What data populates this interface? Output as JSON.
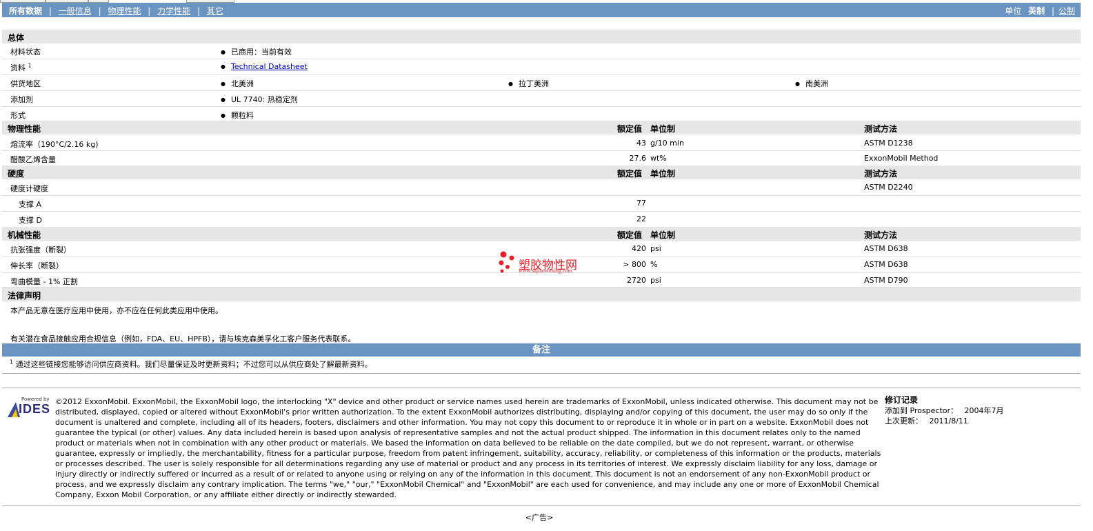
{
  "nav": {
    "tabs": [
      "所有数据",
      "一般信息",
      "物理性能",
      "力学性能",
      "其它"
    ],
    "units_label": "单位",
    "unit_current": "英制",
    "unit_other": "公制"
  },
  "general": {
    "title": "总体",
    "rows": [
      {
        "label": "材料状态",
        "values": [
          "已商用：当前有效"
        ]
      },
      {
        "label": "资料",
        "sup": "1",
        "values": [
          "Technical Datasheet"
        ]
      },
      {
        "label": "供货地区",
        "values": [
          "北美洲",
          "拉丁美洲",
          "南美洲"
        ]
      },
      {
        "label": "添加剂",
        "values": [
          "UL 7740: 热稳定剂"
        ]
      },
      {
        "label": "形式",
        "values": [
          "颗粒料"
        ]
      }
    ]
  },
  "headers": {
    "nominal": "额定值",
    "unit": "单位制",
    "method": "测试方法"
  },
  "physical": {
    "title": "物理性能",
    "rows": [
      {
        "label": "熔流率（190°C/2.16 kg)",
        "value": "43",
        "unit": "g/10 min",
        "method": "ASTM D1238"
      },
      {
        "label": "醋酸乙烯含量",
        "value": "27.6",
        "unit": "wt%",
        "method": "ExxonMobil Method"
      }
    ]
  },
  "hardness": {
    "title": "硬度",
    "rows": [
      {
        "label": "硬度计硬度",
        "value": "",
        "unit": "",
        "method": "ASTM D2240"
      },
      {
        "label": "支撑 A",
        "value": "77",
        "unit": "",
        "method": ""
      },
      {
        "label": "支撑 D",
        "value": "22",
        "unit": "",
        "method": ""
      }
    ]
  },
  "mechanical": {
    "title": "机械性能",
    "rows": [
      {
        "label": "抗张强度（断裂）",
        "value": "420",
        "unit": "psi",
        "method": "ASTM D638"
      },
      {
        "label": "伸长率（断裂）",
        "value": "> 800",
        "unit": "%",
        "method": "ASTM D638"
      },
      {
        "label": "弯曲模量 - 1% 正割",
        "value": "2720",
        "unit": "psi",
        "method": "ASTM D790"
      }
    ]
  },
  "legal": {
    "title": "法律声明",
    "line1": "本产品无意在医疗应用中使用，亦不应在任何此类应用中使用。",
    "line2": "有关潜在食品接触应用合规信息（例如，FDA、EU、HPFB），请与埃克森美孚化工客户服务代表联系。"
  },
  "notes": {
    "title": "备注",
    "sup": "1",
    "text": "通过这些链接您能够访问供应商资料。我们尽量保证及时更新资料；不过您可以从供应商处了解最新资料。"
  },
  "footer": {
    "logo_small": "Powered by",
    "logo_main": "IDES",
    "copyright": "©2012 ExxonMobil. ExxonMobil, the ExxonMobil logo, the interlocking \"X\" device and other product or service names used herein are trademarks of ExxonMobil, unless indicated otherwise. This document may not be distributed, displayed, copied or altered without ExxonMobil's prior written authorization. To the extent ExxonMobil authorizes distributing, displaying and/or copying of this document, the user may do so only if the document is unaltered and complete, including all of its headers, footers, disclaimers and other information. You may not copy this document to or reproduce it in whole or in part on a website. ExxonMobil does not guarantee the typical (or other) values. Any data included herein is based upon analysis of representative samples and not the actual product shipped. The information in this document relates only to the named product or materials when not in combination with any other product or materials. We based the information on data believed to be reliable on the date compiled, but we do not represent, warrant, or otherwise guarantee, expressly or impliedly, the merchantability, fitness for a particular purpose, freedom from patent infringement, suitability, accuracy, reliability, or completeness of this information or the products, materials or processes described. The user is solely responsible for all determinations regarding any use of material or product and any process in its territories of interest. We expressly disclaim liability for any loss, damage or injury directly or indirectly suffered or incurred as a result of or related to anyone using or relying on any of the information in this document. This document is not an endorsement of any non-ExxonMobil product or process, and we expressly disclaim any contrary implication. The terms \"we,\" \"our,\" \"ExxonMobil Chemical\" and \"ExxonMobil\" are each used for convenience, and may include any one or more of ExxonMobil Chemical Company, Exxon Mobil Corporation, or any affiliate either directly or indirectly stewarded.",
    "revision_title": "修订记录",
    "added_label": "添加到 Prospector：",
    "added_value": "2004年7月",
    "updated_label": "上次更新：",
    "updated_value": "2011/8/11",
    "ad": "<广告>"
  },
  "watermark": {
    "title": "塑胶物性网",
    "url": "www.sujiaowuxing.com"
  },
  "colors": {
    "nav_bg": "#6a95c3",
    "section_bg": "#e6e6e6",
    "watermark_red": "#e8202a"
  }
}
